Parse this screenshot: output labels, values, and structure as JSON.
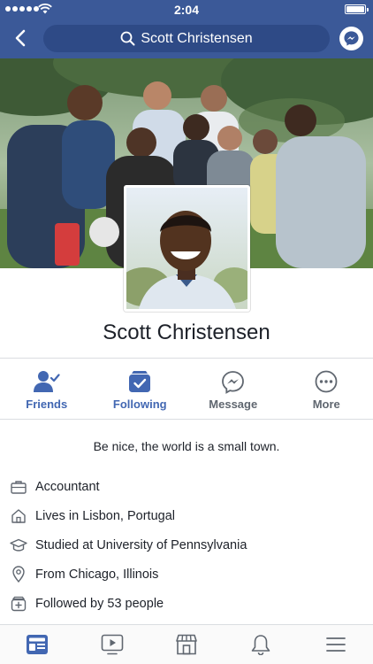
{
  "status_bar": {
    "time": "2:04"
  },
  "nav": {
    "search_text": "Scott Christensen"
  },
  "profile": {
    "name": "Scott Christensen",
    "bio": "Be nice, the world is a small town."
  },
  "actions": [
    {
      "label": "Friends"
    },
    {
      "label": "Following"
    },
    {
      "label": "Message"
    },
    {
      "label": "More"
    }
  ],
  "details": [
    {
      "icon": "briefcase-icon",
      "text": "Accountant"
    },
    {
      "icon": "home-icon",
      "text": "Lives in Lisbon, Portugal"
    },
    {
      "icon": "graduation-cap-icon",
      "text": "Studied at University of Pennsylvania"
    },
    {
      "icon": "location-pin-icon",
      "text": "From Chicago, Illinois"
    },
    {
      "icon": "followers-icon",
      "text": "Followed by 53 people"
    }
  ],
  "tabs": [
    {
      "icon": "news-feed-icon",
      "active": true
    },
    {
      "icon": "video-icon",
      "active": false
    },
    {
      "icon": "marketplace-icon",
      "active": false
    },
    {
      "icon": "notifications-icon",
      "active": false
    },
    {
      "icon": "menu-icon",
      "active": false
    }
  ],
  "colors": {
    "brand": "#3b5998",
    "accent": "#4267b2",
    "muted": "#606770"
  }
}
